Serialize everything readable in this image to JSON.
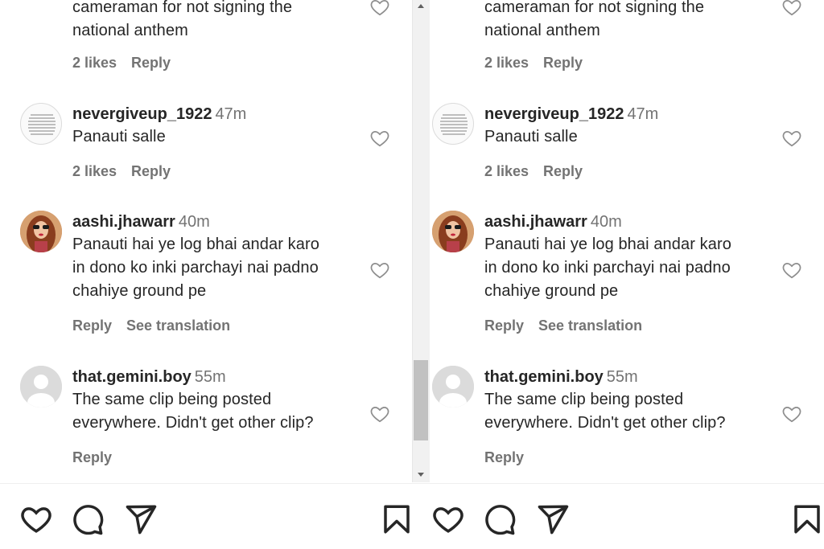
{
  "comments": [
    {
      "text_lines": [
        "cameraman for not signing the",
        "national anthem"
      ],
      "likes": "2 likes",
      "reply": "Reply"
    },
    {
      "username": "nevergiveup_1922",
      "time": "47m",
      "text_lines": [
        "Panauti salle"
      ],
      "likes": "2 likes",
      "reply": "Reply",
      "avatar": "text-image-avatar"
    },
    {
      "username": "aashi.jhawarr",
      "time": "40m",
      "text_lines": [
        "Panauti hai ye log bhai andar karo",
        "in dono ko inki parchayi nai padno",
        "chahiye ground pe"
      ],
      "reply": "Reply",
      "translation": "See translation",
      "avatar": "photo-avatar"
    },
    {
      "username": "that.gemini.boy",
      "time": "55m",
      "text_lines": [
        "The same clip being posted",
        "everywhere. Didn't get other clip?"
      ],
      "reply": "Reply",
      "avatar": "default-avatar"
    }
  ],
  "actions": [
    "heart-icon",
    "comment-icon",
    "share-icon",
    "bookmark-icon"
  ],
  "colors": {
    "text": "#262626",
    "secondary": "#737373",
    "divider": "#efefef",
    "scrollbar_thumb": "#c1c1c1"
  }
}
